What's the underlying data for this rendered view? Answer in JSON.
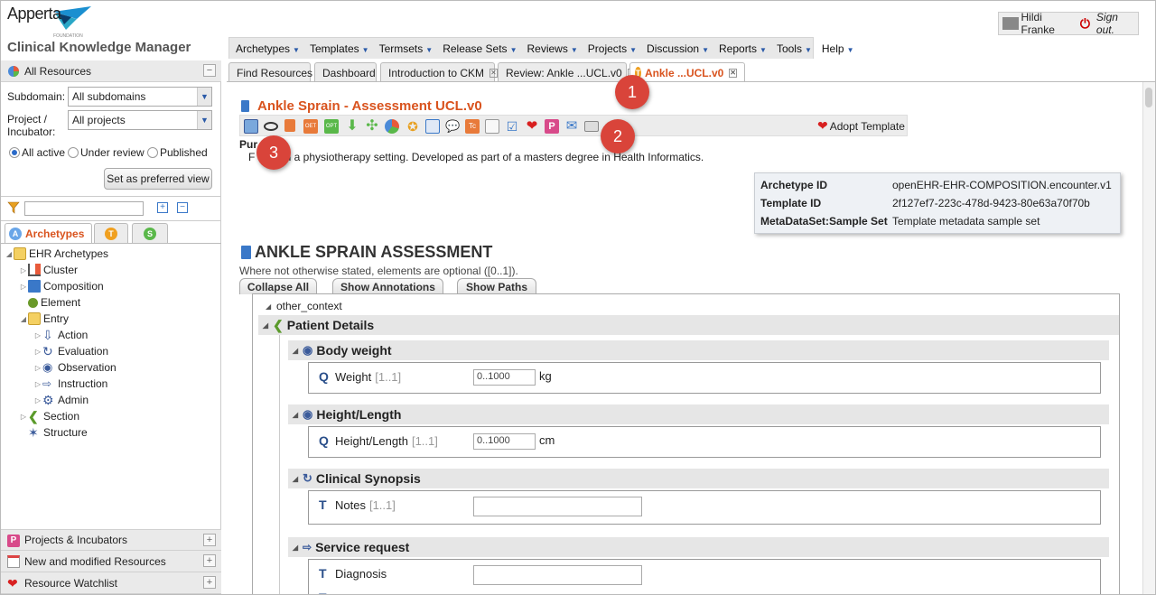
{
  "header": {
    "logo_word": "Apperta",
    "logo_sub": "FOUNDATION",
    "app_name": "Clinical Knowledge Manager",
    "user_name": "Hildi Franke",
    "sign_out": "Sign out."
  },
  "menu": [
    "Archetypes",
    "Templates",
    "Termsets",
    "Release Sets",
    "Reviews",
    "Projects",
    "Discussion",
    "Reports",
    "Tools",
    "Help"
  ],
  "left": {
    "all_resources": "All Resources",
    "subdomain_label": "Subdomain:",
    "subdomain_value": "All subdomains",
    "project_label_1": "Project /",
    "project_label_2": "Incubator:",
    "project_value": "All projects",
    "radio_all_active": "All active",
    "radio_under_review": "Under review",
    "radio_published": "Published",
    "preferred_button": "Set as preferred view",
    "tab_archetypes": "Archetypes",
    "tab_t": "T",
    "tab_s": "S",
    "tree": {
      "root": "EHR Archetypes",
      "cluster": "Cluster",
      "composition": "Composition",
      "element": "Element",
      "entry": "Entry",
      "action": "Action",
      "evaluation": "Evaluation",
      "observation": "Observation",
      "instruction": "Instruction",
      "admin": "Admin",
      "section": "Section",
      "structure": "Structure"
    },
    "projects_incubators": "Projects & Incubators",
    "new_modified": "New and modified Resources",
    "watchlist": "Resource Watchlist"
  },
  "tabs": {
    "find": "Find Resources",
    "dashboard": "Dashboard",
    "intro": "Introduction to CKM",
    "review": "Review: Ankle ...UCL.v0",
    "ankle": "Ankle ...UCL.v0"
  },
  "content": {
    "title": "Ankle Sprain - Assessment UCL.v0",
    "adopt": "Adopt Template",
    "purpose_label": "Pur",
    "purpose_text": "F          n a physiotherapy setting. Developed as part of a masters degree in Health Informatics.",
    "meta": [
      {
        "key": "Archetype ID",
        "value": "openEHR-EHR-COMPOSITION.encounter.v1"
      },
      {
        "key": "Template ID",
        "value": "2f127ef7-223c-478d-9423-80e63a70f70b"
      },
      {
        "key": "MetaDataSet:Sample Set",
        "value": "Template metadata sample set"
      }
    ],
    "section_title": "ANKLE SPRAIN ASSESSMENT",
    "optional_note": "Where not otherwise stated, elements are optional ([0..1]).",
    "collapse_all": "Collapse All",
    "show_annotations": "Show Annotations",
    "show_paths": "Show Paths",
    "other_context": "other_context",
    "patient_details": "Patient Details",
    "body_weight": "Body weight",
    "weight_label": "Weight",
    "weight_occ": "[1..1]",
    "weight_range": "0..1000",
    "weight_unit": "kg",
    "height_length": "Height/Length",
    "height_label": "Height/Length",
    "height_occ": "[1..1]",
    "height_range": "0..1000",
    "height_unit": "cm",
    "clinical_synopsis": "Clinical Synopsis",
    "notes_label": "Notes",
    "notes_occ": "[1..1]",
    "service_request": "Service request",
    "diagnosis_label": "Diagnosis"
  },
  "callouts": [
    "1",
    "2",
    "3"
  ],
  "colors": {
    "accent": "#d9531e",
    "badge": "#d9443a",
    "link_blue": "#2a5aa8"
  }
}
